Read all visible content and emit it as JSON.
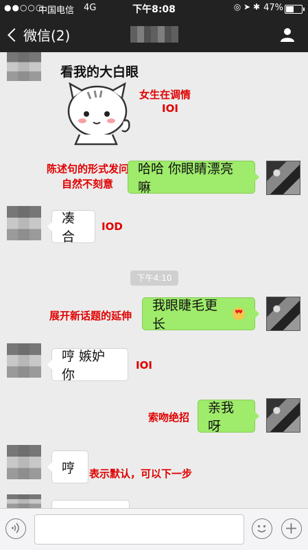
{
  "status_bar": {
    "signal": "●●○○○",
    "carrier": "中国电信",
    "network": "4G",
    "time": "下午8:08",
    "battery_percent": "47%",
    "battery_level": 0.47
  },
  "nav_bar": {
    "back_label": "微信(2)",
    "title": "",
    "back_icon": "chevron-left-icon",
    "profile_icon": "person-icon"
  },
  "messages": [
    {
      "side": "left",
      "type": "sticker",
      "text": "看我的大白眼"
    },
    {
      "side": "right",
      "text": "哈哈 你眼睛漂亮嘛"
    },
    {
      "side": "left",
      "text": "凑合"
    },
    {
      "side": "right",
      "text": "我眼睫毛更长",
      "emoji": "heart-eyes-emoji"
    },
    {
      "side": "left",
      "text": "哼  嫉妒你"
    },
    {
      "side": "right",
      "text": "亲我呀"
    },
    {
      "side": "left",
      "text": "哼"
    }
  ],
  "timestamp": "下午4:10",
  "annotations": {
    "flirt": "女生在调情",
    "ioi1": "IOI",
    "statement": "陈述句的形式发问",
    "natural": "自然不刻意",
    "iod": "IOD",
    "topic": "展开新话题的延伸",
    "ioi2": "IOI",
    "kiss": "索吻绝招",
    "consent": "表示默认，可以下一步"
  },
  "colors": {
    "bar_bg": "#222222",
    "chat_bg": "#ececec",
    "right_bubble": "#9feb6b",
    "annotation": "#e00000"
  }
}
